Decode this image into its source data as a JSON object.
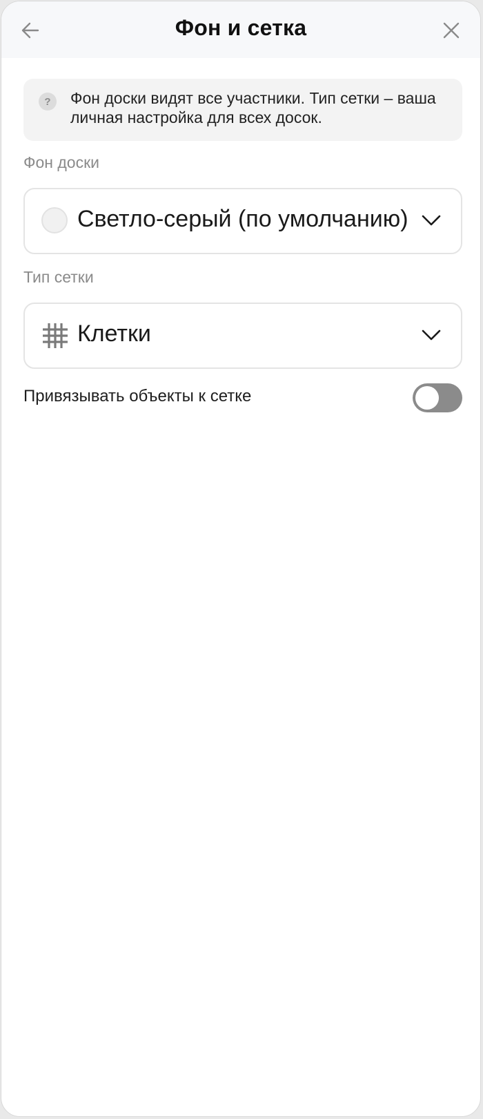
{
  "header": {
    "title": "Фон и сетка",
    "back_icon": "arrow-left-icon",
    "close_icon": "close-icon"
  },
  "info": {
    "icon": "help-icon",
    "text": "Фон доски видят все участники. Тип сетки – ваша личная настройка для всех досок."
  },
  "background": {
    "label": "Фон доски",
    "selected_value": "Светло-серый (по умолчанию)",
    "swatch_color": "#f1f1f1"
  },
  "grid": {
    "label": "Тип сетки",
    "selected_value": "Клетки",
    "icon": "grid-icon"
  },
  "snap": {
    "label": "Привязывать объекты к сетке",
    "enabled": false
  },
  "colors": {
    "header_bg": "#f7f8fa",
    "info_bg": "#f3f3f3",
    "toggle_off": "#8b8b8b",
    "label_gray": "#8a8a8a"
  }
}
